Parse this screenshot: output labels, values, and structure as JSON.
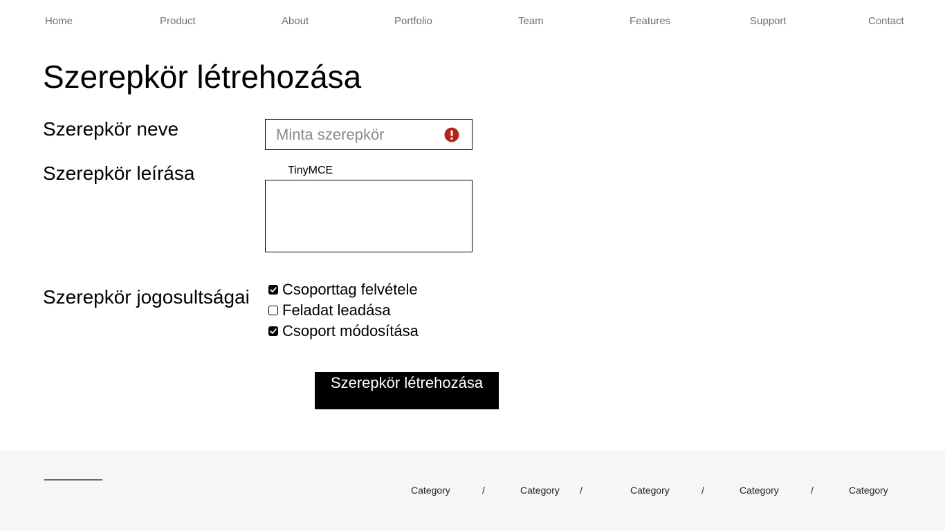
{
  "nav": {
    "items": [
      "Home",
      "Product",
      "About",
      "Portfolio",
      "Team",
      "Features",
      "Support",
      "Contact"
    ]
  },
  "form": {
    "title": "Szerepkör létrehozása",
    "name_label": "Szerepkör neve",
    "name_placeholder": "Minta szerepkör",
    "name_value": "",
    "name_error_icon": "exclamation-circle-icon",
    "description_label": "Szerepkör leírása",
    "editor_caption": "TinyMCE",
    "permissions_label": "Szerepkör jogosultságai",
    "permissions": [
      {
        "label": "Csoporttag felvétele",
        "checked": true
      },
      {
        "label": "Feladat leadása",
        "checked": false
      },
      {
        "label": "Csoport módosítása",
        "checked": true
      }
    ],
    "submit_label": "Szerepkör létrehozása"
  },
  "footer": {
    "links": [
      "Category",
      "Category",
      "Category",
      "Category",
      "Category"
    ],
    "separator": "/"
  },
  "colors": {
    "error": "#b3261e",
    "nav_text": "#6f6f6f",
    "footer_bg": "#f5f6f8",
    "button_bg": "#000000",
    "button_text": "#ffffff"
  }
}
